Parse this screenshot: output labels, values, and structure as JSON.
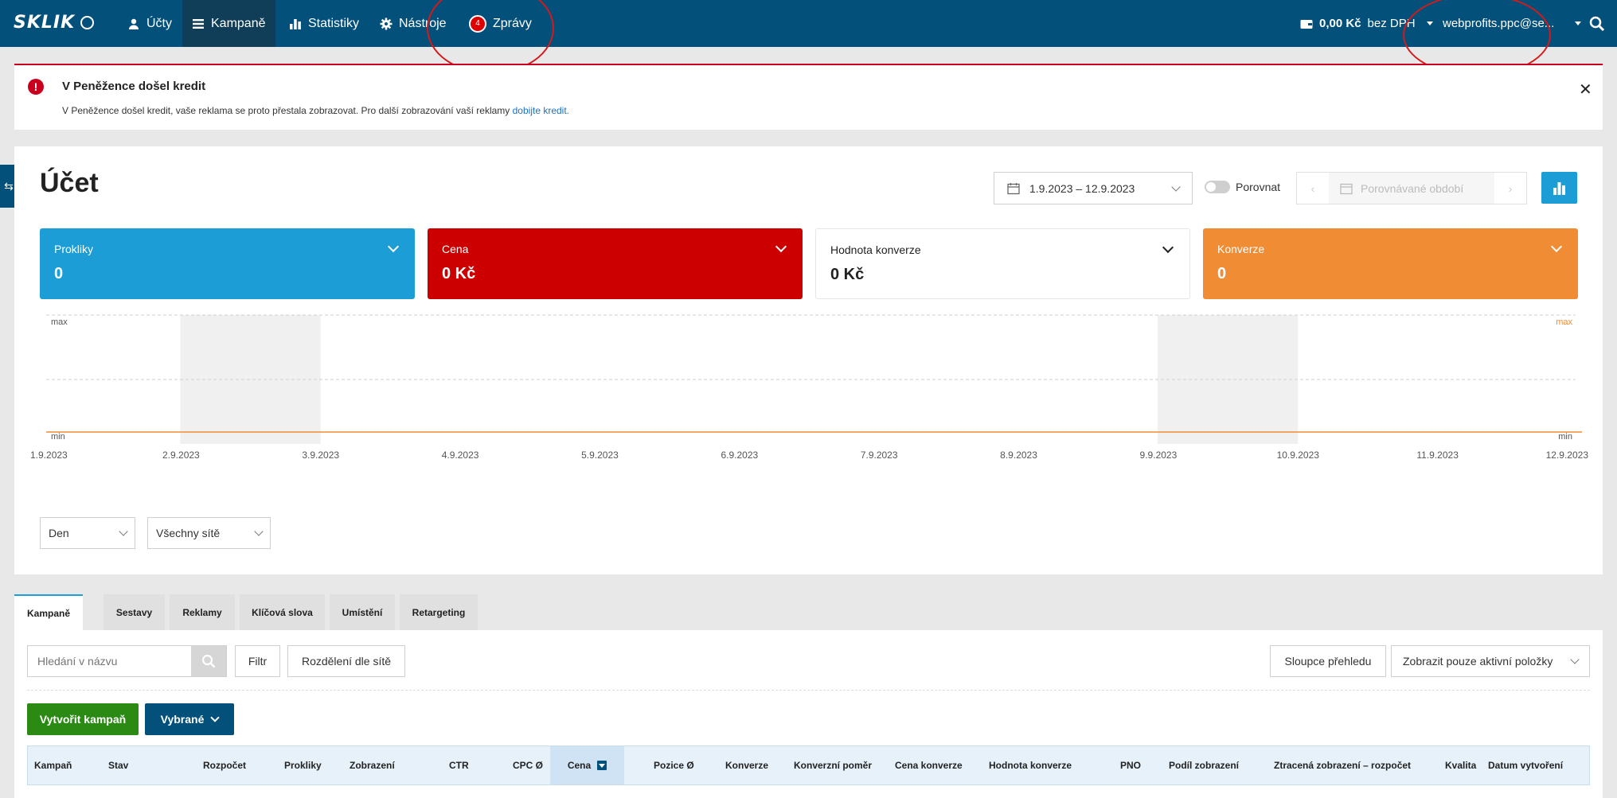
{
  "nav": {
    "logo": "SKLIK",
    "items": [
      {
        "label": "Účty",
        "icon": "user-icon"
      },
      {
        "label": "Kampaně",
        "icon": "list-icon"
      },
      {
        "label": "Statistiky",
        "icon": "bar-chart-icon"
      },
      {
        "label": "Nástroje",
        "icon": "gear-icon"
      },
      {
        "label": "Zprávy",
        "icon": "notification-badge"
      }
    ],
    "messages_count": "4",
    "credit_amount": "0,00 Kč",
    "credit_suffix": "bez DPH",
    "user": "webprofits.ppc@se..."
  },
  "alert": {
    "title": "V Peněžence došel kredit",
    "text": "V Peněžence došel kredit, vaše reklama se proto přestala zobrazovat. Pro další zobrazování vaší reklamy",
    "link": "dobijte kredit."
  },
  "account": {
    "title": "Účet",
    "date_range": "1.9.2023 – 12.9.2023",
    "compare_label": "Porovnat",
    "compare_placeholder": "Porovnávané období"
  },
  "kpis": [
    {
      "label": "Prokliky",
      "value": "0",
      "color": "#1d9dd5"
    },
    {
      "label": "Cena",
      "value": "0 Kč",
      "color": "#cc0000"
    },
    {
      "label": "Hodnota konverze",
      "value": "0 Kč",
      "color": "#ffffff"
    },
    {
      "label": "Konverze",
      "value": "0",
      "color": "#f08c33"
    }
  ],
  "chart_data": {
    "type": "line",
    "x": [
      "1.9.2023",
      "2.9.2023",
      "3.9.2023",
      "4.9.2023",
      "5.9.2023",
      "6.9.2023",
      "7.9.2023",
      "8.9.2023",
      "9.9.2023",
      "10.9.2023",
      "11.9.2023",
      "12.9.2023"
    ],
    "y_left_labels": [
      "max",
      "min"
    ],
    "y_right_labels": [
      "max",
      "min"
    ],
    "series": [
      {
        "values": [
          0,
          0,
          0,
          0,
          0,
          0,
          0,
          0,
          0,
          0,
          0,
          0
        ],
        "color": "#f08c33"
      }
    ],
    "shaded_weekends": [
      [
        "2.9.2023",
        "3.9.2023"
      ],
      [
        "9.9.2023",
        "10.9.2023"
      ]
    ],
    "grid": true
  },
  "filters": {
    "granularity": "Den",
    "network": "Všechny sítě"
  },
  "tabs": [
    "Kampaně",
    "Sestavy",
    "Reklamy",
    "Klíčová slova",
    "Umístění",
    "Retargeting"
  ],
  "toolbar": {
    "search_placeholder": "Hledání v názvu",
    "filter": "Filtr",
    "split": "Rozdělení dle sítě",
    "columns": "Sloupce přehledu",
    "active_only": "Zobrazit pouze aktivní položky",
    "create": "Vytvořit kampaň",
    "selected": "Vybrané"
  },
  "table": {
    "headers": [
      "Kampaň",
      "Stav",
      "Rozpočet",
      "Prokliky",
      "Zobrazení",
      "CTR",
      "CPC Ø",
      "Cena",
      "Pozice Ø",
      "Konverze",
      "Konverzní poměr",
      "Cena konverze",
      "Hodnota konverze",
      "PNO",
      "Podíl zobrazení",
      "Ztracená zobrazení – rozpočet",
      "Kvalita",
      "Datum vytvoření"
    ],
    "sorted_column": "Cena"
  }
}
